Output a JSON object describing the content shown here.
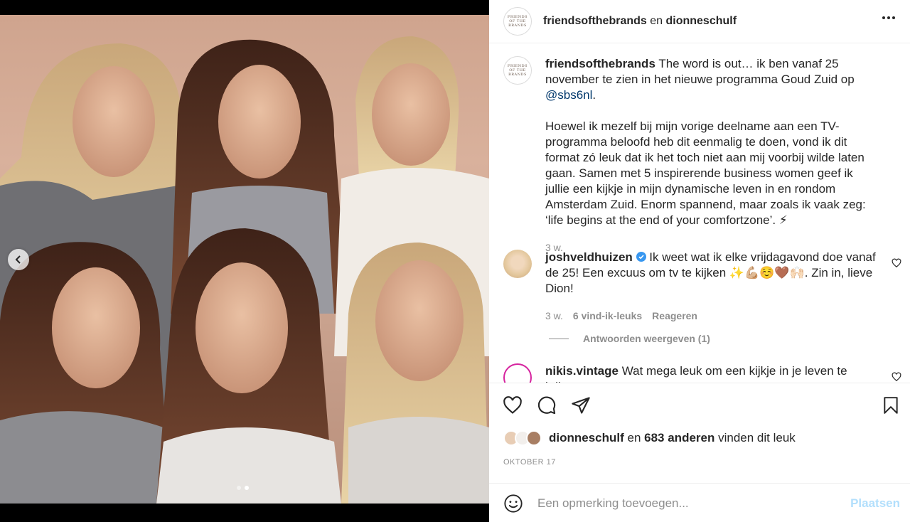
{
  "header": {
    "account1": "friendsofthebrands",
    "connector": " en ",
    "account2": "dionneschulf",
    "more_icon": "more-horizontal-icon",
    "logo_line1": "FRIENDS",
    "logo_line2": "OF THE",
    "logo_line3": "BRANDS"
  },
  "caption": {
    "username": "friendsofthebrands",
    "text_part1": " The word is out… ik ben vanaf 25 november te zien in het nieuwe programma Goud Zuid op ",
    "mention": "@sbs6nl",
    "text_part2": ".",
    "paragraph2": "Hoewel ik mezelf bij mijn vorige deelname aan een TV-programma beloofd heb dit eenmalig te doen, vond ik dit format zó leuk dat ik het toch niet aan mij voorbij wilde laten gaan. Samen met 5 inspirerende business women geef ik jullie een kijkje in mijn dynamische leven in en rondom Amsterdam Zuid. Enorm spannend, maar zoals ik vaak zeg: ‘life begins at the end of your comfortzone’. ⚡",
    "time": "3 w."
  },
  "comments": [
    {
      "username": "joshveldhuizen",
      "text": " Ik weet wat ik elke vrijdagavond doe vanaf de 25! Een excuus om tv te kijken ✨💪🏼☺️🤎🙌🏻. Zin in, lieve Dion!",
      "time": "3 w.",
      "likes": "6 vind-ik-leuks",
      "reply": "Reageren",
      "view_replies": "Antwoorden weergeven (1)"
    },
    {
      "username": "nikis.vintage",
      "text": " Wat mega leuk om een kijkje in je leven te krijgen"
    }
  ],
  "actions": {
    "liked_by_user": "dionneschulf",
    "likes_middle": " en ",
    "likes_count": "683 anderen",
    "likes_suffix": " vinden dit leuk",
    "date": "OKTOBER 17"
  },
  "add_comment": {
    "placeholder": "Een opmerking toevoegen...",
    "post_label": "Plaatsen"
  },
  "colors": {
    "link": "#00376b",
    "muted": "#8e8e8e",
    "post_disabled": "#b2dffc",
    "verified": "#3897f0"
  }
}
